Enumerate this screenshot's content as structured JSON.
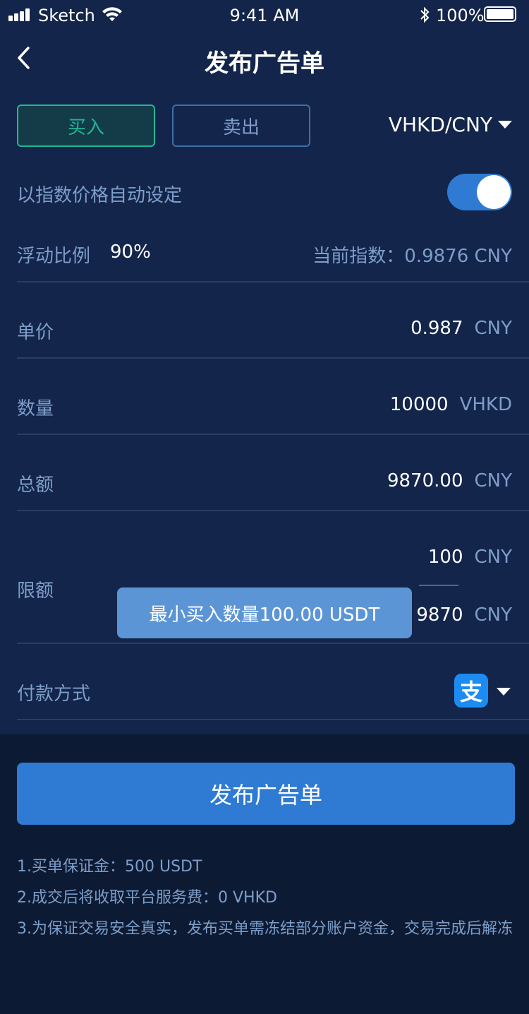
{
  "status_bar": {
    "carrier": "Sketch",
    "time": "9:41 AM",
    "battery": "100%"
  },
  "nav": {
    "title": "发布广告单"
  },
  "tabs": {
    "buy": "买入",
    "sell": "卖出"
  },
  "pair": "VHKD/CNY",
  "auto_index": {
    "label": "以指数价格自动设定",
    "enabled": true
  },
  "float_ratio": {
    "label": "浮动比例",
    "value": "90%",
    "current_index_label": "当前指数：0.9876 CNY"
  },
  "fields": {
    "unit_price": {
      "label": "单价",
      "value": "0.987",
      "unit": "CNY"
    },
    "quantity": {
      "label": "数量",
      "value": "10000",
      "unit": "VHKD"
    },
    "total": {
      "label": "总额",
      "value": "9870.00",
      "unit": "CNY"
    },
    "limit": {
      "label": "限额",
      "min": "100",
      "min_unit": "CNY",
      "max": "9870",
      "max_unit": "CNY"
    },
    "payment": {
      "label": "付款方式",
      "icon": "alipay-icon"
    }
  },
  "toast": "最小买入数量100.00 USDT",
  "publish_button": "发布广告单",
  "notes": [
    "1.买单保证金：500 USDT",
    "2.成交后将收取平台服务费：0 VHKD",
    "3.为保证交易安全真实，发布买单需冻结部分账户资金，交易完成后解冻"
  ],
  "colors": {
    "background_top": "#13254a",
    "background_bottom": "#0c1a33",
    "accent_blue": "#2f7ad2",
    "buy_green": "#20b795",
    "muted_text": "#7d9ec9"
  }
}
